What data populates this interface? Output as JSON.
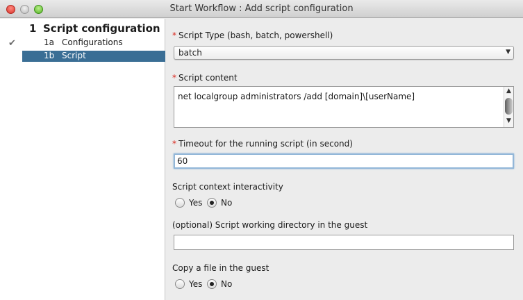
{
  "window": {
    "title": "Start Workflow : Add script configuration"
  },
  "sidebar": {
    "step": {
      "number": "1",
      "title": "Script configuration"
    },
    "substeps": [
      {
        "number": "1a",
        "label": "Configurations"
      },
      {
        "number": "1b",
        "label": "Script"
      }
    ]
  },
  "form": {
    "required_marker": "*",
    "script_type": {
      "label": "Script Type (bash, batch, powershell)",
      "value": "batch"
    },
    "script_content": {
      "label": "Script content",
      "value": "net localgroup administrators /add [domain]\\[userName]"
    },
    "timeout": {
      "label": "Timeout for the running script (in second)",
      "value": "60"
    },
    "interactivity": {
      "label": "Script context interactivity",
      "options": [
        "Yes",
        "No"
      ],
      "selected": "No"
    },
    "workdir": {
      "label": "(optional) Script working directory in the guest",
      "value": ""
    },
    "copy_file": {
      "label": "Copy a file in the guest",
      "options": [
        "Yes",
        "No"
      ],
      "selected": "No"
    }
  },
  "colors": {
    "selection": "#3a6e95",
    "required": "#d9261c",
    "focus_ring": "#93b7d8"
  }
}
